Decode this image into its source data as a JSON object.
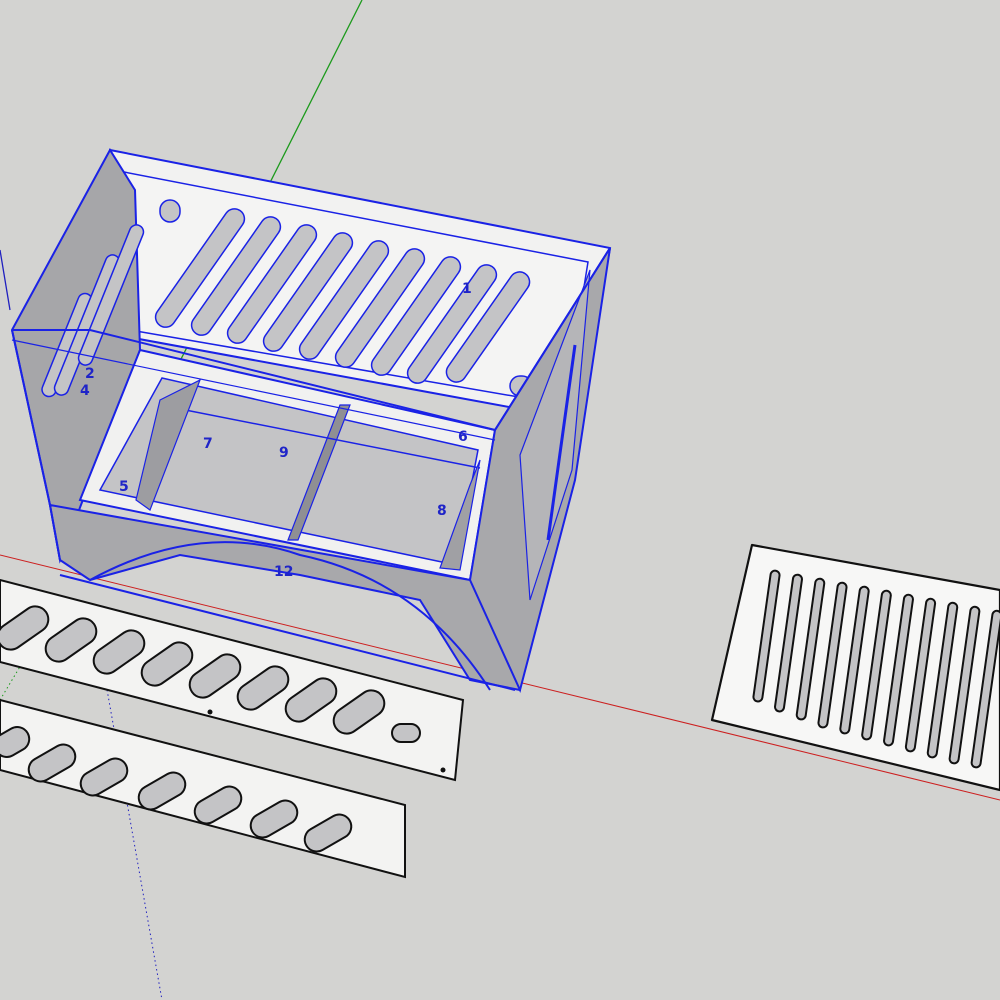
{
  "app": {
    "canvas_bg": "#d3d3d1"
  },
  "colors": {
    "selection": "#1a22e6",
    "panel_face": "#f3f3f2",
    "panel_shade": "#a6a6a9",
    "panel_inner": "#c4c4c6",
    "edge": "#111111",
    "axis_red": "#cc2020",
    "axis_green": "#1c9a1c",
    "axis_blue": "#2020c0"
  },
  "icons": {
    "model": "3d-box-model",
    "axes": "axis-lines"
  },
  "part_labels": {
    "l1": "1",
    "l2": "2",
    "l4": "4",
    "l5": "5",
    "l6": "6",
    "l7": "7",
    "l8": "8",
    "l9": "9",
    "l12": "12"
  }
}
